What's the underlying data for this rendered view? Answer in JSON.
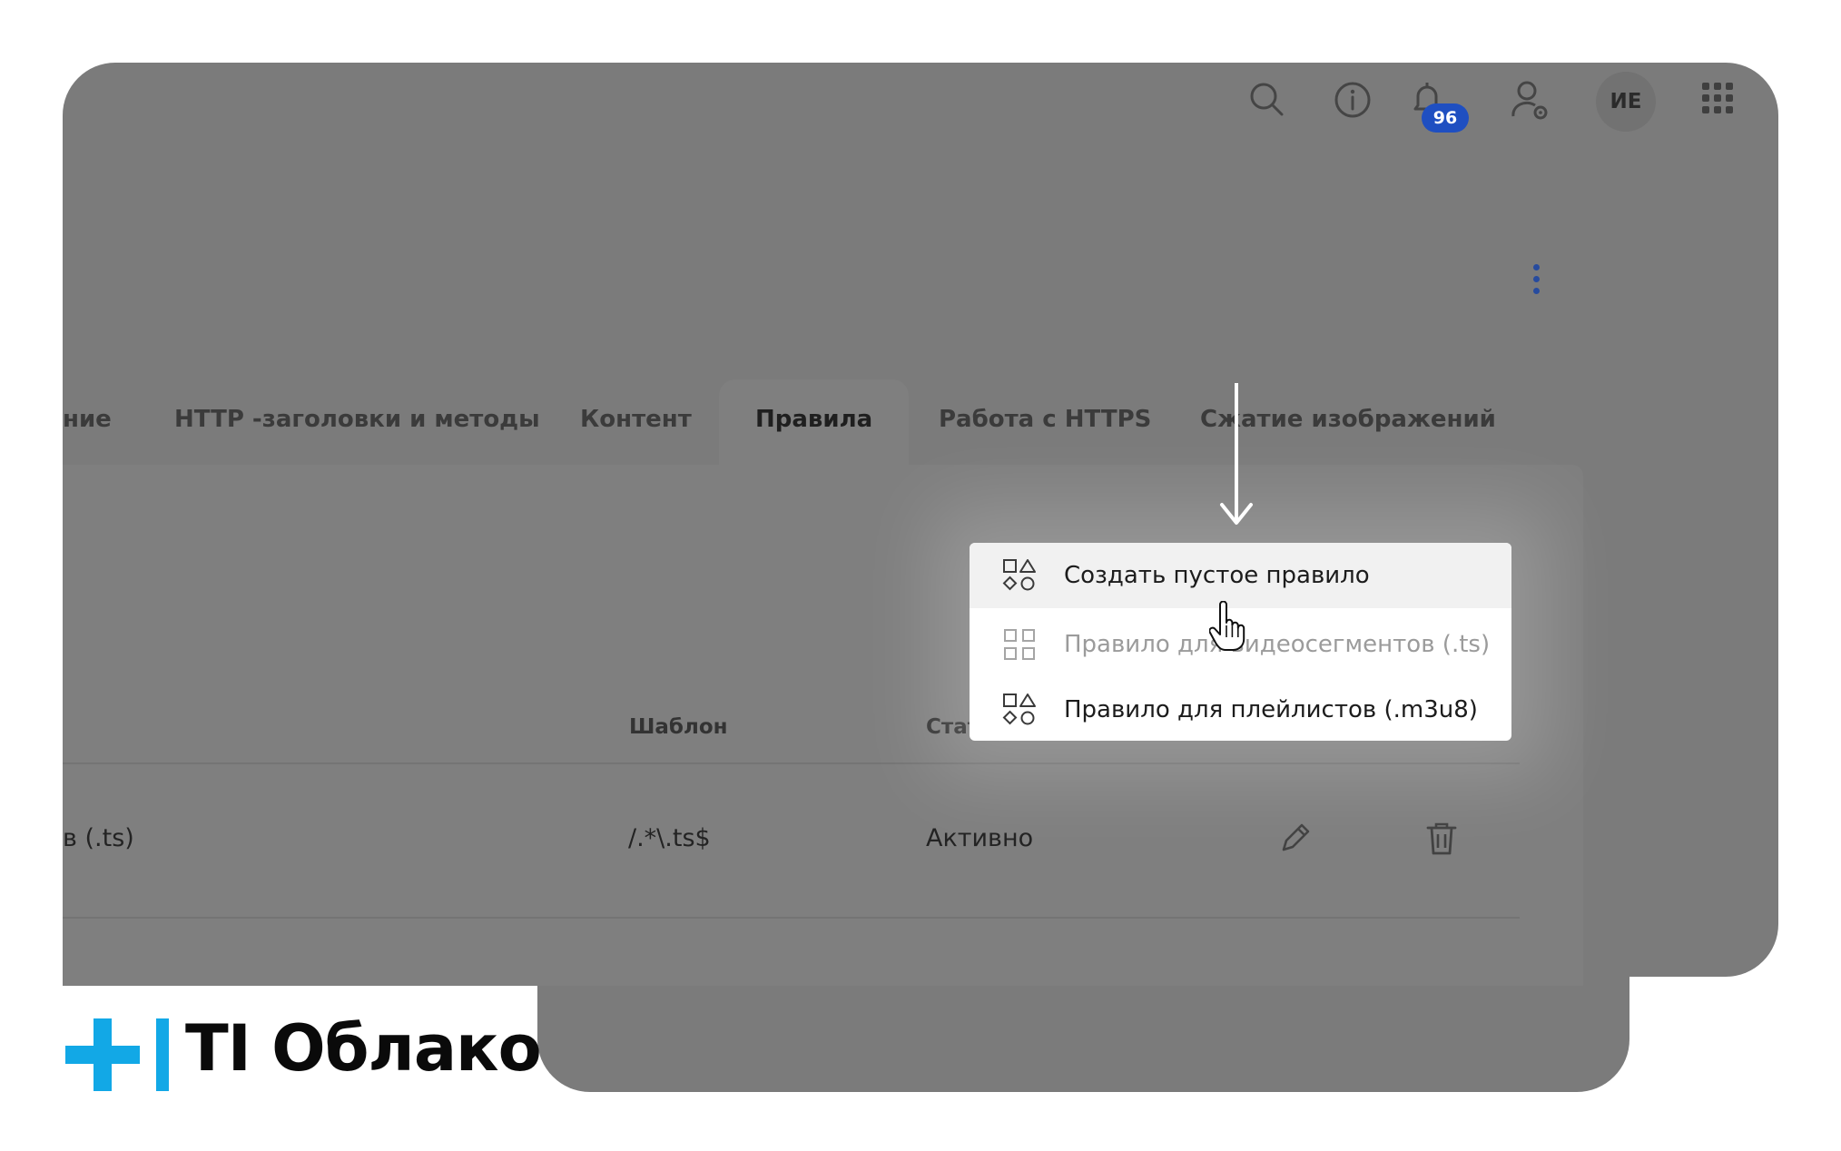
{
  "header": {
    "notifications_count": "96",
    "avatar_initials": "ИЕ"
  },
  "tabs": [
    {
      "label": "ние",
      "active": false
    },
    {
      "label": "HTTP -заголовки и методы",
      "active": false
    },
    {
      "label": "Контент",
      "active": false
    },
    {
      "label": "Правила",
      "active": true
    },
    {
      "label": "Работа с HTTPS",
      "active": false
    },
    {
      "label": "Сжатие изображений",
      "active": false
    }
  ],
  "table": {
    "columns": {
      "template": "Шаблон",
      "status": "Стат"
    },
    "rows": [
      {
        "name": "в (.ts)",
        "template": "/.*\\.ts$",
        "status": "Активно"
      }
    ]
  },
  "menu": {
    "items": [
      {
        "label": "Создать пустое правило",
        "state": "hover",
        "icon": "shapes-icon"
      },
      {
        "label": "Правило для видеосегментов (.ts)",
        "state": "disabled",
        "icon": "grid-icon"
      },
      {
        "label": "Правило для плейлистов (.m3u8)",
        "state": "normal",
        "icon": "shapes-icon"
      }
    ]
  },
  "brand": {
    "name": "TI Облако",
    "accent": "#12a8e6"
  },
  "colors": {
    "overlay": "#7b7b7b",
    "badge": "#1f4fc1",
    "kebab": "#274b9e"
  }
}
